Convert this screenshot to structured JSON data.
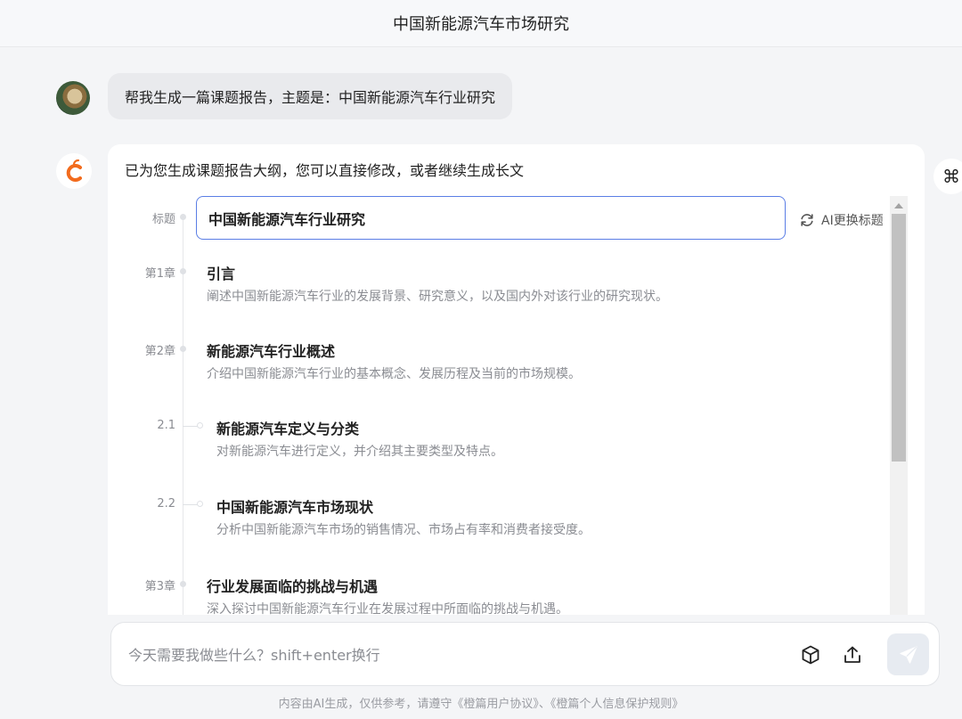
{
  "header": {
    "title": "中国新能源汽车市场研究"
  },
  "user_message": {
    "text": "帮我生成一篇课题报告，主题是：中国新能源汽车行业研究"
  },
  "ai_message": {
    "intro": "已为您生成课题报告大纲，您可以直接修改，或者继续生成长文",
    "title_label": "标题",
    "title_value": "中国新能源汽车行业研究",
    "retitle_label": "AI更换标题",
    "sections": [
      {
        "label": "第1章",
        "heading": "引言",
        "desc": "阐述中国新能源汽车行业的发展背景、研究意义，以及国内外对该行业的研究现状。"
      },
      {
        "label": "第2章",
        "heading": "新能源汽车行业概述",
        "desc": "介绍中国新能源汽车行业的基本概念、发展历程及当前的市场规模。"
      },
      {
        "label": "2.1",
        "heading": "新能源汽车定义与分类",
        "desc": "对新能源汽车进行定义，并介绍其主要类型及特点。"
      },
      {
        "label": "2.2",
        "heading": "中国新能源汽车市场现状",
        "desc": "分析中国新能源汽车市场的销售情况、市场占有率和消费者接受度。"
      },
      {
        "label": "第3章",
        "heading": "行业发展面临的挑战与机遇",
        "desc": "深入探讨中国新能源汽车行业在发展过程中所面临的挑战与机遇。"
      }
    ]
  },
  "composer": {
    "placeholder": "今天需要我做些什么？shift+enter换行"
  },
  "footer": {
    "text": "内容由AI生成，仅供参考，请遵守《橙篇用户协议》、《橙篇个人信息保护规则》"
  },
  "icons": {
    "shortcut": "⌘"
  },
  "colors": {
    "brand_orange": "#f26b1d",
    "input_border": "#5b7ee5"
  }
}
